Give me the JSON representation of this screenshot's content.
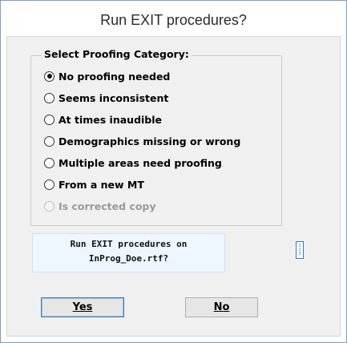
{
  "dialog": {
    "title": "Run EXIT procedures?"
  },
  "proofing": {
    "legend": "Select Proofing Category:",
    "options": [
      {
        "label": "No proofing needed",
        "checked": true,
        "enabled": true
      },
      {
        "label": "Seems inconsistent",
        "checked": false,
        "enabled": true
      },
      {
        "label": "At times inaudible",
        "checked": false,
        "enabled": true
      },
      {
        "label": "Demographics missing or wrong",
        "checked": false,
        "enabled": true
      },
      {
        "label": "Multiple areas need proofing",
        "checked": false,
        "enabled": true
      },
      {
        "label": "From a new MT",
        "checked": false,
        "enabled": true
      },
      {
        "label": "Is corrected copy",
        "checked": false,
        "enabled": false
      }
    ]
  },
  "message": {
    "line1": "Run EXIT procedures on",
    "line2": "InProg_Doe.rtf?"
  },
  "info_icon": {
    "name": "info-icon",
    "text": "1​2​3"
  },
  "buttons": {
    "yes_label": "Yes",
    "no_label": "No"
  },
  "colors": {
    "accent": "#3c7fb1",
    "message_bg": "#eef7ff",
    "dialog_bg": "#f0f0f0"
  }
}
